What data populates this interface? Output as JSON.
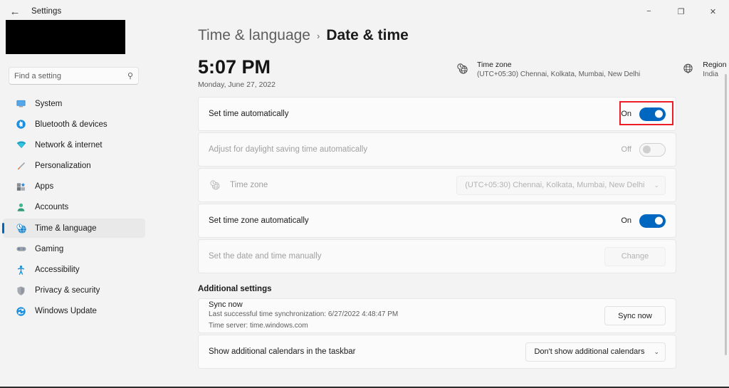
{
  "window": {
    "title": "Settings",
    "back_icon": "back-arrow-icon",
    "minimize": "−",
    "maximize": "❐",
    "close": "✕"
  },
  "search": {
    "placeholder": "Find a setting",
    "value": "",
    "icon": "search-icon"
  },
  "sidebar": {
    "items": [
      {
        "label": "System",
        "icon": "monitor-icon",
        "active": false
      },
      {
        "label": "Bluetooth & devices",
        "icon": "bluetooth-icon",
        "active": false
      },
      {
        "label": "Network & internet",
        "icon": "wifi-icon",
        "active": false
      },
      {
        "label": "Personalization",
        "icon": "paintbrush-icon",
        "active": false
      },
      {
        "label": "Apps",
        "icon": "apps-icon",
        "active": false
      },
      {
        "label": "Accounts",
        "icon": "person-icon",
        "active": false
      },
      {
        "label": "Time & language",
        "icon": "clock-globe-icon",
        "active": true
      },
      {
        "label": "Gaming",
        "icon": "gamepad-icon",
        "active": false
      },
      {
        "label": "Accessibility",
        "icon": "accessibility-icon",
        "active": false
      },
      {
        "label": "Privacy & security",
        "icon": "shield-icon",
        "active": false
      },
      {
        "label": "Windows Update",
        "icon": "update-sync-icon",
        "active": false
      }
    ]
  },
  "breadcrumb": {
    "parent": "Time & language",
    "separator": "›",
    "current": "Date & time"
  },
  "clock": {
    "time": "5:07 PM",
    "date": "Monday, June 27, 2022"
  },
  "info": {
    "timezone": {
      "icon": "clock-globe-icon",
      "title": "Time zone",
      "value": "(UTC+05:30) Chennai, Kolkata, Mumbai, New Delhi"
    },
    "region": {
      "icon": "globe-icon",
      "title": "Region",
      "value": "India"
    }
  },
  "settings_rows": {
    "set_time_automatically": {
      "label": "Set time automatically",
      "state": "On",
      "toggle_on": true,
      "disabled": false,
      "highlighted": true
    },
    "daylight_saving": {
      "label": "Adjust for daylight saving time automatically",
      "state": "Off",
      "toggle_on": false,
      "disabled": true
    },
    "time_zone": {
      "icon": "clock-globe-icon",
      "label": "Time zone",
      "value": "(UTC+05:30) Chennai, Kolkata, Mumbai, New Delhi",
      "caret": "⌄",
      "disabled": true
    },
    "set_time_zone_automatically": {
      "label": "Set time zone automatically",
      "state": "On",
      "toggle_on": true,
      "disabled": false
    },
    "set_manually": {
      "label": "Set the date and time manually",
      "button_label": "Change",
      "disabled": true
    }
  },
  "additional": {
    "header": "Additional settings",
    "sync": {
      "title": "Sync now",
      "last_sync": "Last successful time synchronization: 6/27/2022 4:48:47 PM",
      "time_server": "Time server: time.windows.com",
      "button_label": "Sync now"
    },
    "calendars": {
      "label": "Show additional calendars in the taskbar",
      "value": "Don't show additional calendars",
      "caret": "⌄"
    }
  },
  "colors": {
    "accent": "#0067c0",
    "annotation": "#ee1c25",
    "window_bg": "#f3f3f3",
    "card_bg": "#fbfbfb"
  }
}
